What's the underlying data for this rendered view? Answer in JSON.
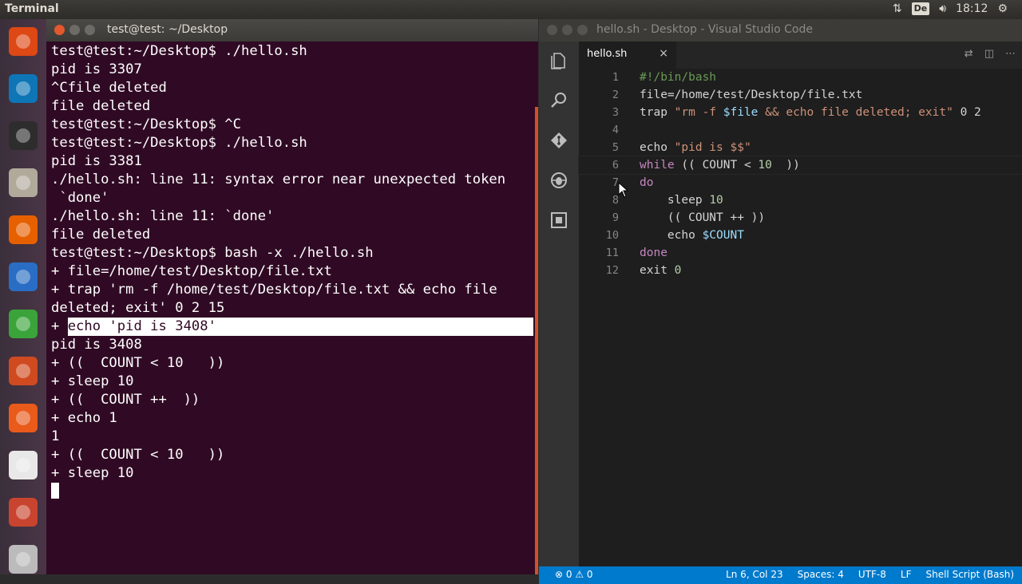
{
  "panel": {
    "app_title": "Terminal",
    "keyboard_layout": "De",
    "clock": "18:12"
  },
  "launcher": [
    {
      "name": "ubuntu-dash-icon",
      "color": "#dd4814"
    },
    {
      "name": "vscode-icon",
      "color": "#0e75b6"
    },
    {
      "name": "terminal-icon",
      "color": "#2d2d2d"
    },
    {
      "name": "files-icon",
      "color": "#b1aa9b"
    },
    {
      "name": "firefox-icon",
      "color": "#e66000"
    },
    {
      "name": "writer-icon",
      "color": "#2a6dc4"
    },
    {
      "name": "calc-icon",
      "color": "#3aa33a"
    },
    {
      "name": "impress-icon",
      "color": "#d04a20"
    },
    {
      "name": "software-center-icon",
      "color": "#e95a1b"
    },
    {
      "name": "amazon-icon",
      "color": "#e8e8e8"
    },
    {
      "name": "system-settings-icon",
      "color": "#c8442e"
    },
    {
      "name": "dvd-icon",
      "color": "#bbbbbb"
    }
  ],
  "terminal": {
    "title": "test@test: ~/Desktop",
    "lines": [
      "test@test:~/Desktop$ ./hello.sh",
      "pid is 3307",
      "^Cfile deleted",
      "file deleted",
      "test@test:~/Desktop$ ^C",
      "test@test:~/Desktop$ ./hello.sh",
      "pid is 3381",
      "./hello.sh: line 11: syntax error near unexpected token",
      " `done'",
      "./hello.sh: line 11: `done'",
      "file deleted",
      "test@test:~/Desktop$ bash -x ./hello.sh",
      "+ file=/home/test/Desktop/file.txt",
      "+ trap 'rm -f /home/test/Desktop/file.txt && echo file",
      "deleted; exit' 0 2 15"
    ],
    "selected_prefix": "+ ",
    "selected_line": "echo 'pid is 3408'",
    "lines_after": [
      "pid is 3408",
      "+ ((  COUNT < 10   ))",
      "+ sleep 10",
      "+ ((  COUNT ++  ))",
      "+ echo 1",
      "1",
      "+ ((  COUNT < 10   ))",
      "+ sleep 10"
    ]
  },
  "vscode": {
    "title": "hello.sh - Desktop - Visual Studio Code",
    "tab_label": "hello.sh",
    "tab_close": "×",
    "line_numbers": [
      "1",
      "2",
      "3",
      "4",
      "5",
      "6",
      "7",
      "8",
      "9",
      "10",
      "11",
      "12"
    ],
    "status": {
      "errors": "0",
      "warnings": "0",
      "position": "Ln 6, Col 23",
      "spaces": "Spaces: 4",
      "encoding": "UTF-8",
      "eol": "LF",
      "language": "Shell Script (Bash)"
    }
  },
  "code_tokens": [
    [
      {
        "t": "#!/bin/bash",
        "c": "comment"
      }
    ],
    [
      {
        "t": "file=/home/test/Desktop/file.txt",
        "c": "plain"
      }
    ],
    [
      {
        "t": "trap ",
        "c": "plain"
      },
      {
        "t": "\"rm -f ",
        "c": "string"
      },
      {
        "t": "$file",
        "c": "var"
      },
      {
        "t": " && echo file deleted; exit\"",
        "c": "string"
      },
      {
        "t": " 0 2",
        "c": "plain"
      }
    ],
    [],
    [
      {
        "t": "echo ",
        "c": "plain"
      },
      {
        "t": "\"pid is $$\"",
        "c": "string"
      }
    ],
    [
      {
        "t": "while",
        "c": "keyword"
      },
      {
        "t": " (( COUNT < ",
        "c": "plain"
      },
      {
        "t": "10",
        "c": "num"
      },
      {
        "t": "  ))",
        "c": "plain"
      }
    ],
    [
      {
        "t": "do",
        "c": "keyword"
      }
    ],
    [
      {
        "t": "    sleep ",
        "c": "plain"
      },
      {
        "t": "10",
        "c": "num"
      }
    ],
    [
      {
        "t": "    (( COUNT ++ ))",
        "c": "plain"
      }
    ],
    [
      {
        "t": "    echo ",
        "c": "plain"
      },
      {
        "t": "$COUNT",
        "c": "var"
      }
    ],
    [
      {
        "t": "done",
        "c": "keyword"
      }
    ],
    [
      {
        "t": "exit ",
        "c": "plain"
      },
      {
        "t": "0",
        "c": "num"
      }
    ]
  ]
}
